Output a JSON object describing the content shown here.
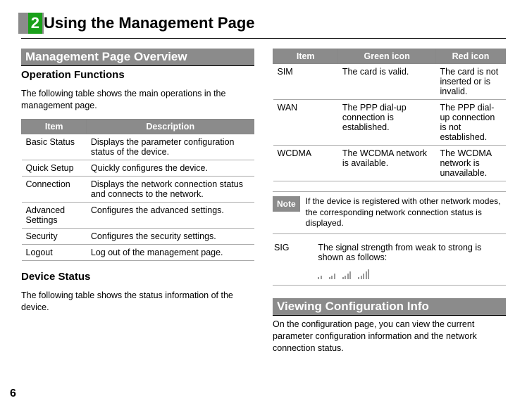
{
  "chapter": {
    "num": "2",
    "title": "Using the Management Page"
  },
  "left": {
    "section_title": " Management Page Overview",
    "sub1": "Operation Functions",
    "p1": "The following table shows the main operations in the management page.",
    "table1": {
      "headers": [
        "Item",
        "Description"
      ],
      "rows": [
        [
          "Basic Status",
          "Displays the parameter configuration status of the device."
        ],
        [
          "Quick Setup",
          "Quickly configures the device."
        ],
        [
          "Connection",
          "Displays the network connection status and connects to the network."
        ],
        [
          "Advanced Settings",
          "Configures the advanced settings."
        ],
        [
          "Security",
          "Configures the security settings."
        ],
        [
          "Logout",
          "Log out of the management page."
        ]
      ]
    },
    "sub2": "Device Status",
    "p2": "The following table shows the status information of the device."
  },
  "right": {
    "table2": {
      "headers": [
        "Item",
        "Green icon",
        "Red icon"
      ],
      "rows": [
        [
          "SIM",
          "The card is valid.",
          "The card is not inserted or is invalid."
        ],
        [
          "WAN",
          "The PPP dial-up connection is established.",
          "The PPP dial-up connection is not established."
        ],
        [
          "WCDMA",
          "The WCDMA network is available.",
          "The WCDMA network is unavailable."
        ]
      ]
    },
    "note": {
      "tag": "Note",
      "text": "If the device is registered with other network modes, the corresponding network connection status is displayed."
    },
    "sig": {
      "label": "SIG",
      "text": "The signal strength from weak to strong is shown as follows:"
    },
    "section2_title": " Viewing Configuration Info",
    "p3": "On the configuration page, you can view the current parameter configuration information and the network connection status."
  },
  "page_num": "6"
}
